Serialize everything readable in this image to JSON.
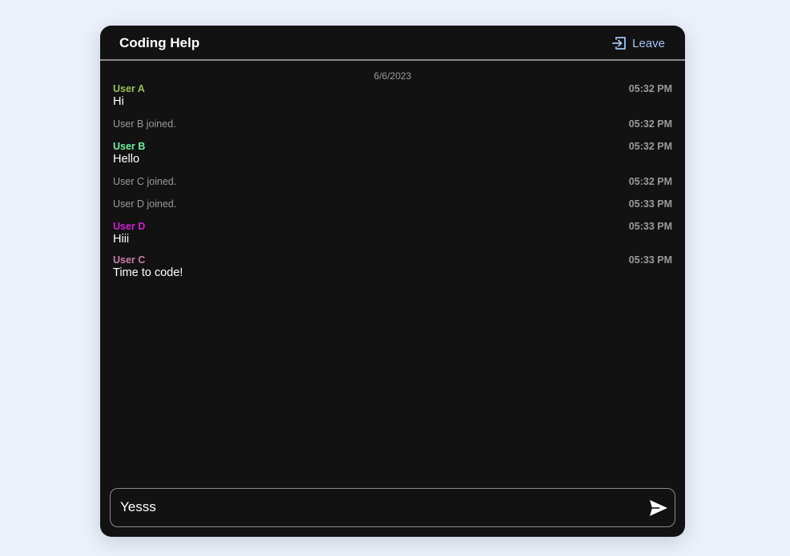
{
  "header": {
    "title": "Coding Help",
    "leave_label": "Leave",
    "leave_icon": "exit-icon",
    "accent_color": "#a4c2f4"
  },
  "chat": {
    "date": "6/6/2023",
    "messages": [
      {
        "type": "user",
        "sender": "User A",
        "sender_color": "#9bbf5e",
        "text": "Hi",
        "time": "05:32 PM"
      },
      {
        "type": "system",
        "text": "User B joined.",
        "time": "05:32 PM"
      },
      {
        "type": "user",
        "sender": "User B",
        "sender_color": "#6ff0a0",
        "text": "Hello",
        "time": "05:32 PM"
      },
      {
        "type": "system",
        "text": "User C joined.",
        "time": "05:32 PM"
      },
      {
        "type": "system",
        "text": "User D joined.",
        "time": "05:33 PM"
      },
      {
        "type": "user",
        "sender": "User D",
        "sender_color": "#d41fd4",
        "text": "Hiii",
        "time": "05:33 PM"
      },
      {
        "type": "user",
        "sender": "User C",
        "sender_color": "#c97fa9",
        "text": "Time to code!",
        "time": "05:33 PM"
      }
    ]
  },
  "composer": {
    "value": "Yesss",
    "send_icon": "send-icon"
  }
}
